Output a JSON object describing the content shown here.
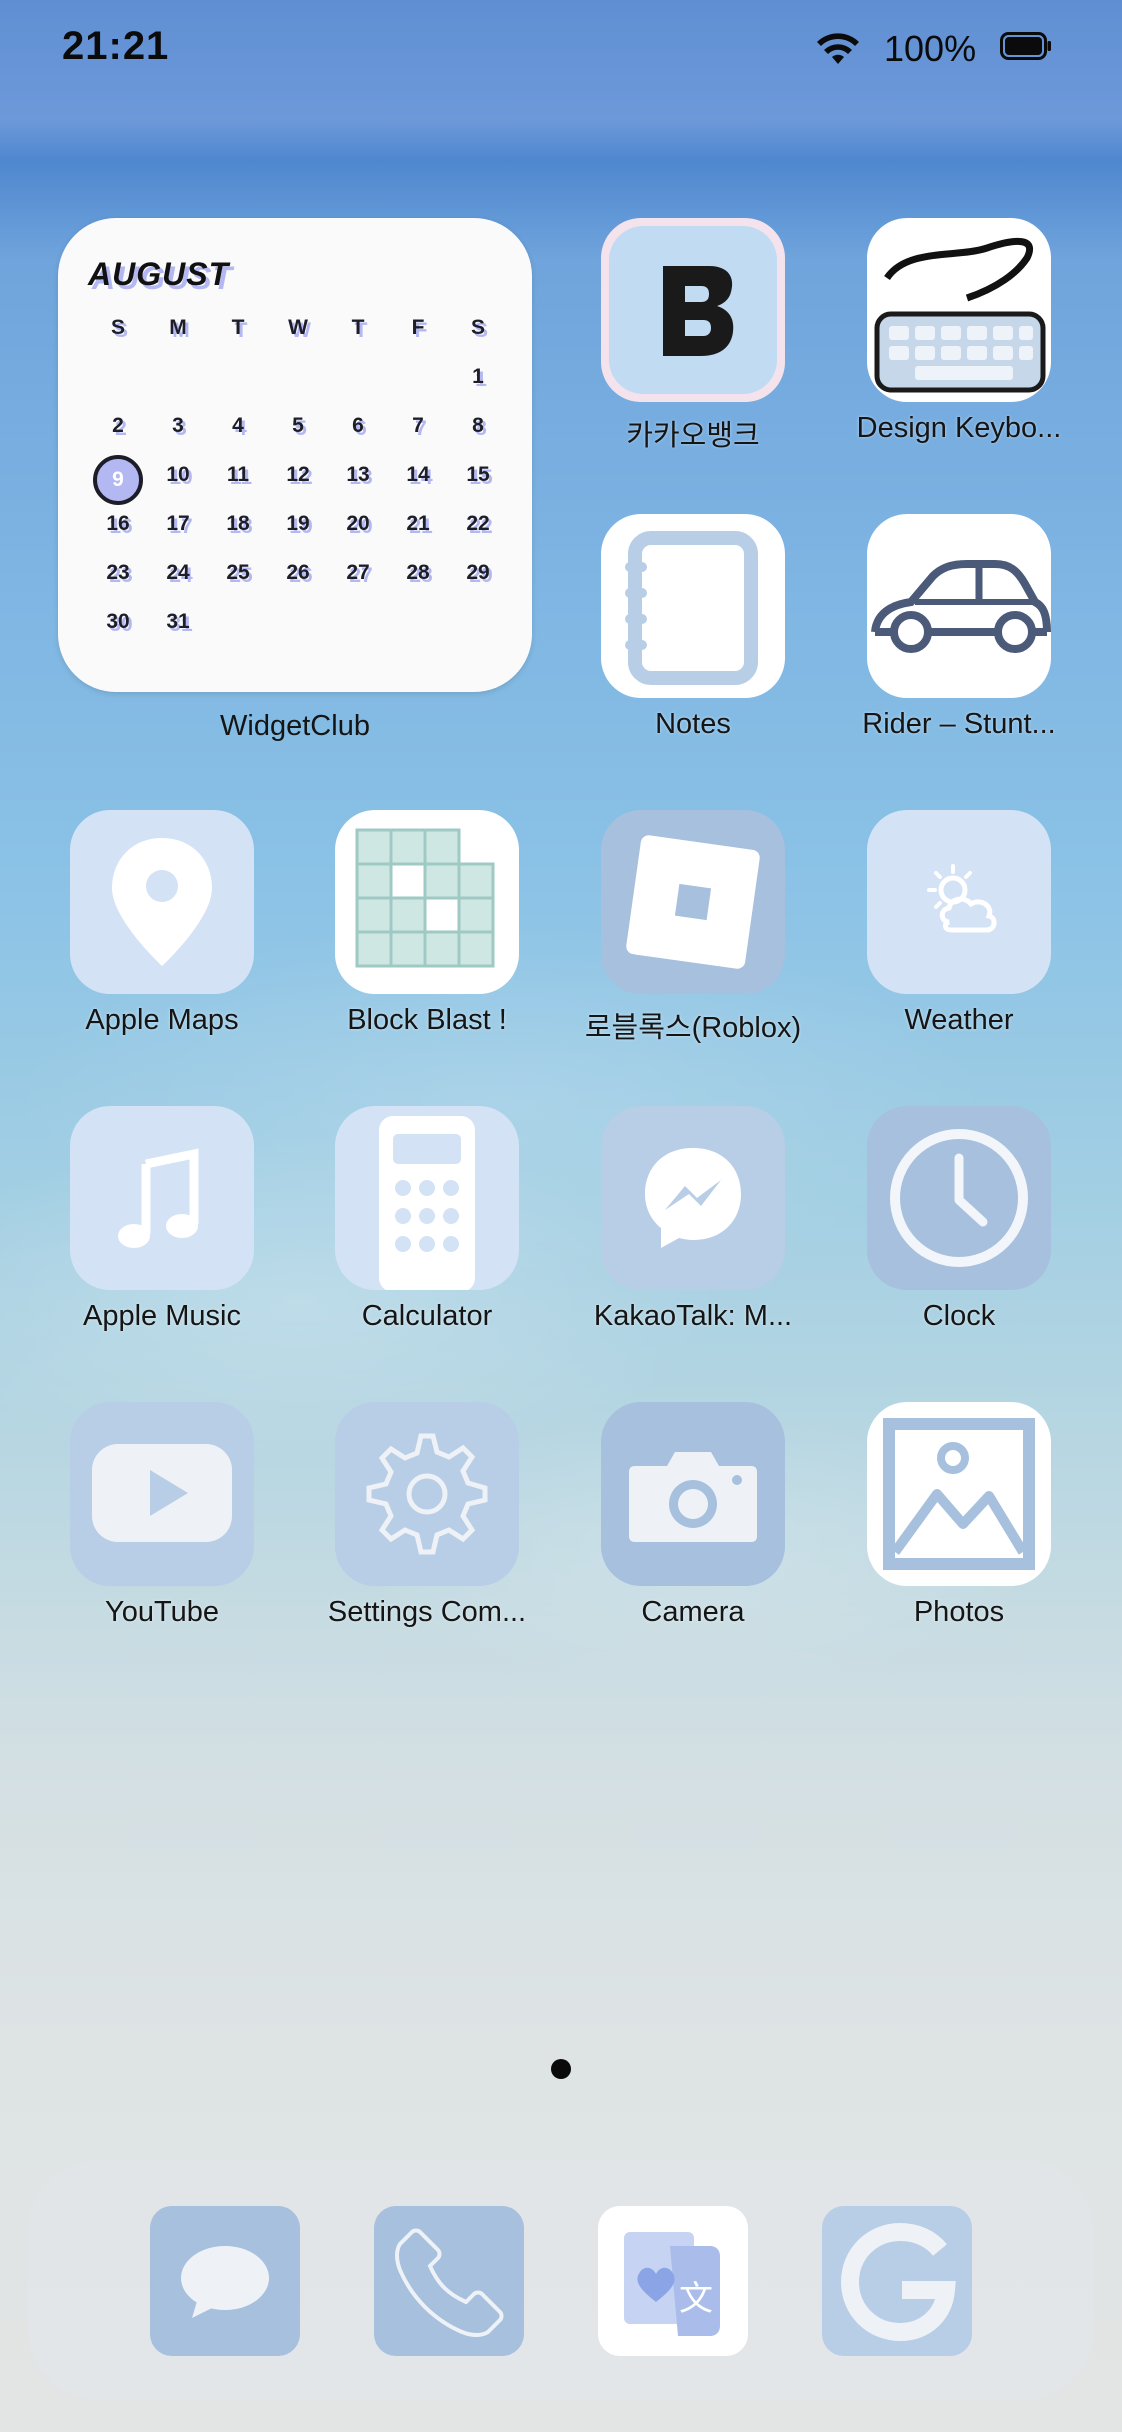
{
  "status_bar": {
    "time": "21:21",
    "battery_percent": "100%"
  },
  "widget": {
    "month": "AUGUST",
    "weekdays": [
      "S",
      "M",
      "T",
      "W",
      "T",
      "F",
      "S"
    ],
    "weeks": [
      [
        "",
        "",
        "",
        "",
        "",
        "",
        "1"
      ],
      [
        "2",
        "3",
        "4",
        "5",
        "6",
        "7",
        "8"
      ],
      [
        "9",
        "10",
        "11",
        "12",
        "13",
        "14",
        "15"
      ],
      [
        "16",
        "17",
        "18",
        "19",
        "20",
        "21",
        "22"
      ],
      [
        "23",
        "24",
        "25",
        "26",
        "27",
        "28",
        "29"
      ],
      [
        "30",
        "31",
        "",
        "",
        "",
        "",
        ""
      ]
    ],
    "today": "9",
    "label": "WidgetClub"
  },
  "apps": [
    {
      "label": "카카오뱅크",
      "icon": "kakaobank-b-icon"
    },
    {
      "label": "Design Keybo...",
      "icon": "keyboard-icon"
    },
    {
      "label": "Notes",
      "icon": "notebook-icon"
    },
    {
      "label": "Rider – Stunt...",
      "icon": "car-icon"
    },
    {
      "label": "Apple Maps",
      "icon": "map-pin-icon"
    },
    {
      "label": "Block Blast !",
      "icon": "block-puzzle-icon"
    },
    {
      "label": "로블록스(Roblox)",
      "icon": "roblox-icon"
    },
    {
      "label": "Weather",
      "icon": "sun-cloud-icon"
    },
    {
      "label": "Apple Music",
      "icon": "music-note-icon"
    },
    {
      "label": "Calculator",
      "icon": "calculator-icon"
    },
    {
      "label": "KakaoTalk: M...",
      "icon": "messenger-icon"
    },
    {
      "label": "Clock",
      "icon": "clock-icon"
    },
    {
      "label": "YouTube",
      "icon": "youtube-play-icon"
    },
    {
      "label": "Settings Com...",
      "icon": "gear-icon"
    },
    {
      "label": "Camera",
      "icon": "camera-icon"
    },
    {
      "label": "Photos",
      "icon": "photo-icon"
    }
  ],
  "dock": [
    {
      "icon": "messages-bubble-icon"
    },
    {
      "icon": "phone-icon"
    },
    {
      "icon": "translate-icon"
    },
    {
      "icon": "google-g-icon"
    }
  ],
  "colors": {
    "icon_light": "#d4e2f5",
    "icon_mid": "#b8cde6",
    "icon_dark": "#a6c0de",
    "widget_accent": "#b3b8f2"
  }
}
